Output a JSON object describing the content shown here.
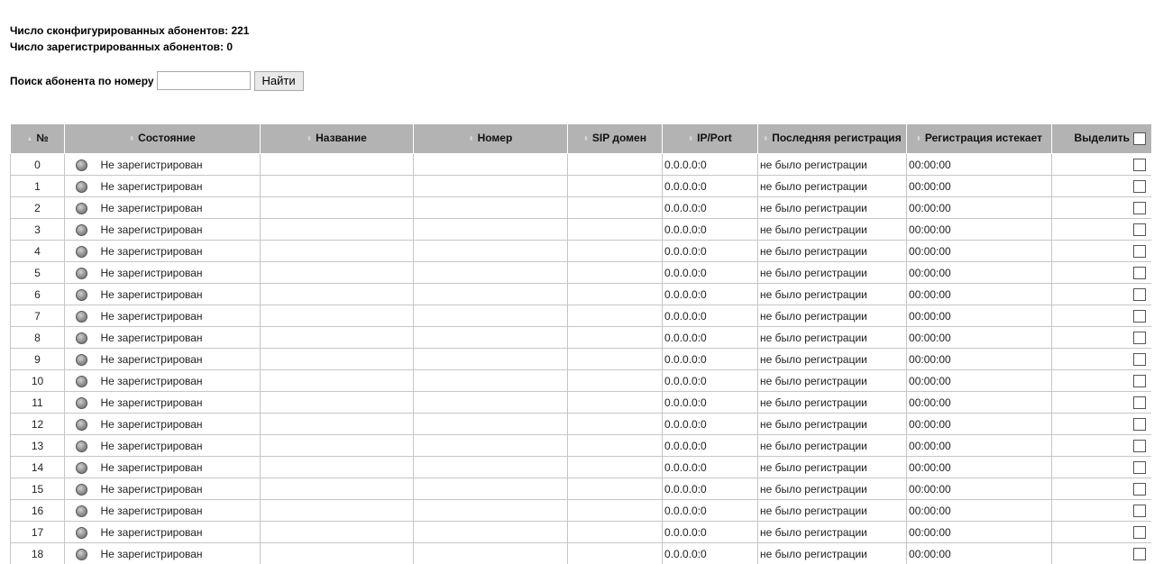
{
  "stats": {
    "configured": "Число сконфигурированных абонентов: 221",
    "registered": "Число зарегистрированных абонентов: 0"
  },
  "search": {
    "label": "Поиск абонента по номеру",
    "value": "",
    "button": "Найти"
  },
  "table": {
    "headers": {
      "num": "№",
      "state": "Состояние",
      "name": "Название",
      "number": "Номер",
      "sip_domain": "SIP домен",
      "ip_port": "IP/Port",
      "last_reg": "Последняя регистрация",
      "reg_expires": "Регистрация истекает",
      "select": "Выделить"
    },
    "rows": [
      {
        "num": "0",
        "state": "Не зарегистрирован",
        "name": "",
        "number": "",
        "domain": "",
        "ip": "0.0.0.0:0",
        "last": "не было регистрации",
        "expires": "00:00:00"
      },
      {
        "num": "1",
        "state": "Не зарегистрирован",
        "name": "",
        "number": "",
        "domain": "",
        "ip": "0.0.0.0:0",
        "last": "не было регистрации",
        "expires": "00:00:00"
      },
      {
        "num": "2",
        "state": "Не зарегистрирован",
        "name": "",
        "number": "",
        "domain": "",
        "ip": "0.0.0.0:0",
        "last": "не было регистрации",
        "expires": "00:00:00"
      },
      {
        "num": "3",
        "state": "Не зарегистрирован",
        "name": "",
        "number": "",
        "domain": "",
        "ip": "0.0.0.0:0",
        "last": "не было регистрации",
        "expires": "00:00:00"
      },
      {
        "num": "4",
        "state": "Не зарегистрирован",
        "name": "",
        "number": "",
        "domain": "",
        "ip": "0.0.0.0:0",
        "last": "не было регистрации",
        "expires": "00:00:00"
      },
      {
        "num": "5",
        "state": "Не зарегистрирован",
        "name": "",
        "number": "",
        "domain": "",
        "ip": "0.0.0.0:0",
        "last": "не было регистрации",
        "expires": "00:00:00"
      },
      {
        "num": "6",
        "state": "Не зарегистрирован",
        "name": "",
        "number": "",
        "domain": "",
        "ip": "0.0.0.0:0",
        "last": "не было регистрации",
        "expires": "00:00:00"
      },
      {
        "num": "7",
        "state": "Не зарегистрирован",
        "name": "",
        "number": "",
        "domain": "",
        "ip": "0.0.0.0:0",
        "last": "не было регистрации",
        "expires": "00:00:00"
      },
      {
        "num": "8",
        "state": "Не зарегистрирован",
        "name": "",
        "number": "",
        "domain": "",
        "ip": "0.0.0.0:0",
        "last": "не было регистрации",
        "expires": "00:00:00"
      },
      {
        "num": "9",
        "state": "Не зарегистрирован",
        "name": "",
        "number": "",
        "domain": "",
        "ip": "0.0.0.0:0",
        "last": "не было регистрации",
        "expires": "00:00:00"
      },
      {
        "num": "10",
        "state": "Не зарегистрирован",
        "name": "",
        "number": "",
        "domain": "",
        "ip": "0.0.0.0:0",
        "last": "не было регистрации",
        "expires": "00:00:00"
      },
      {
        "num": "11",
        "state": "Не зарегистрирован",
        "name": "",
        "number": "",
        "domain": "",
        "ip": "0.0.0.0:0",
        "last": "не было регистрации",
        "expires": "00:00:00"
      },
      {
        "num": "12",
        "state": "Не зарегистрирован",
        "name": "",
        "number": "",
        "domain": "",
        "ip": "0.0.0.0:0",
        "last": "не было регистрации",
        "expires": "00:00:00"
      },
      {
        "num": "13",
        "state": "Не зарегистрирован",
        "name": "",
        "number": "",
        "domain": "",
        "ip": "0.0.0.0:0",
        "last": "не было регистрации",
        "expires": "00:00:00"
      },
      {
        "num": "14",
        "state": "Не зарегистрирован",
        "name": "",
        "number": "",
        "domain": "",
        "ip": "0.0.0.0:0",
        "last": "не было регистрации",
        "expires": "00:00:00"
      },
      {
        "num": "15",
        "state": "Не зарегистрирован",
        "name": "",
        "number": "",
        "domain": "",
        "ip": "0.0.0.0:0",
        "last": "не было регистрации",
        "expires": "00:00:00"
      },
      {
        "num": "16",
        "state": "Не зарегистрирован",
        "name": "",
        "number": "",
        "domain": "",
        "ip": "0.0.0.0:0",
        "last": "не было регистрации",
        "expires": "00:00:00"
      },
      {
        "num": "17",
        "state": "Не зарегистрирован",
        "name": "",
        "number": "",
        "domain": "",
        "ip": "0.0.0.0:0",
        "last": "не было регистрации",
        "expires": "00:00:00"
      },
      {
        "num": "18",
        "state": "Не зарегистрирован",
        "name": "",
        "number": "",
        "domain": "",
        "ip": "0.0.0.0:0",
        "last": "не было регистрации",
        "expires": "00:00:00"
      }
    ]
  },
  "colors": {
    "header_bg": "#b3b3b3",
    "cell_border": "#c6c6c6",
    "status_led": "#8a8a8a"
  },
  "icons": {
    "status": "grey-status-led-icon",
    "sort": "sort-arrows-icon",
    "select": "checkbox-icon"
  }
}
